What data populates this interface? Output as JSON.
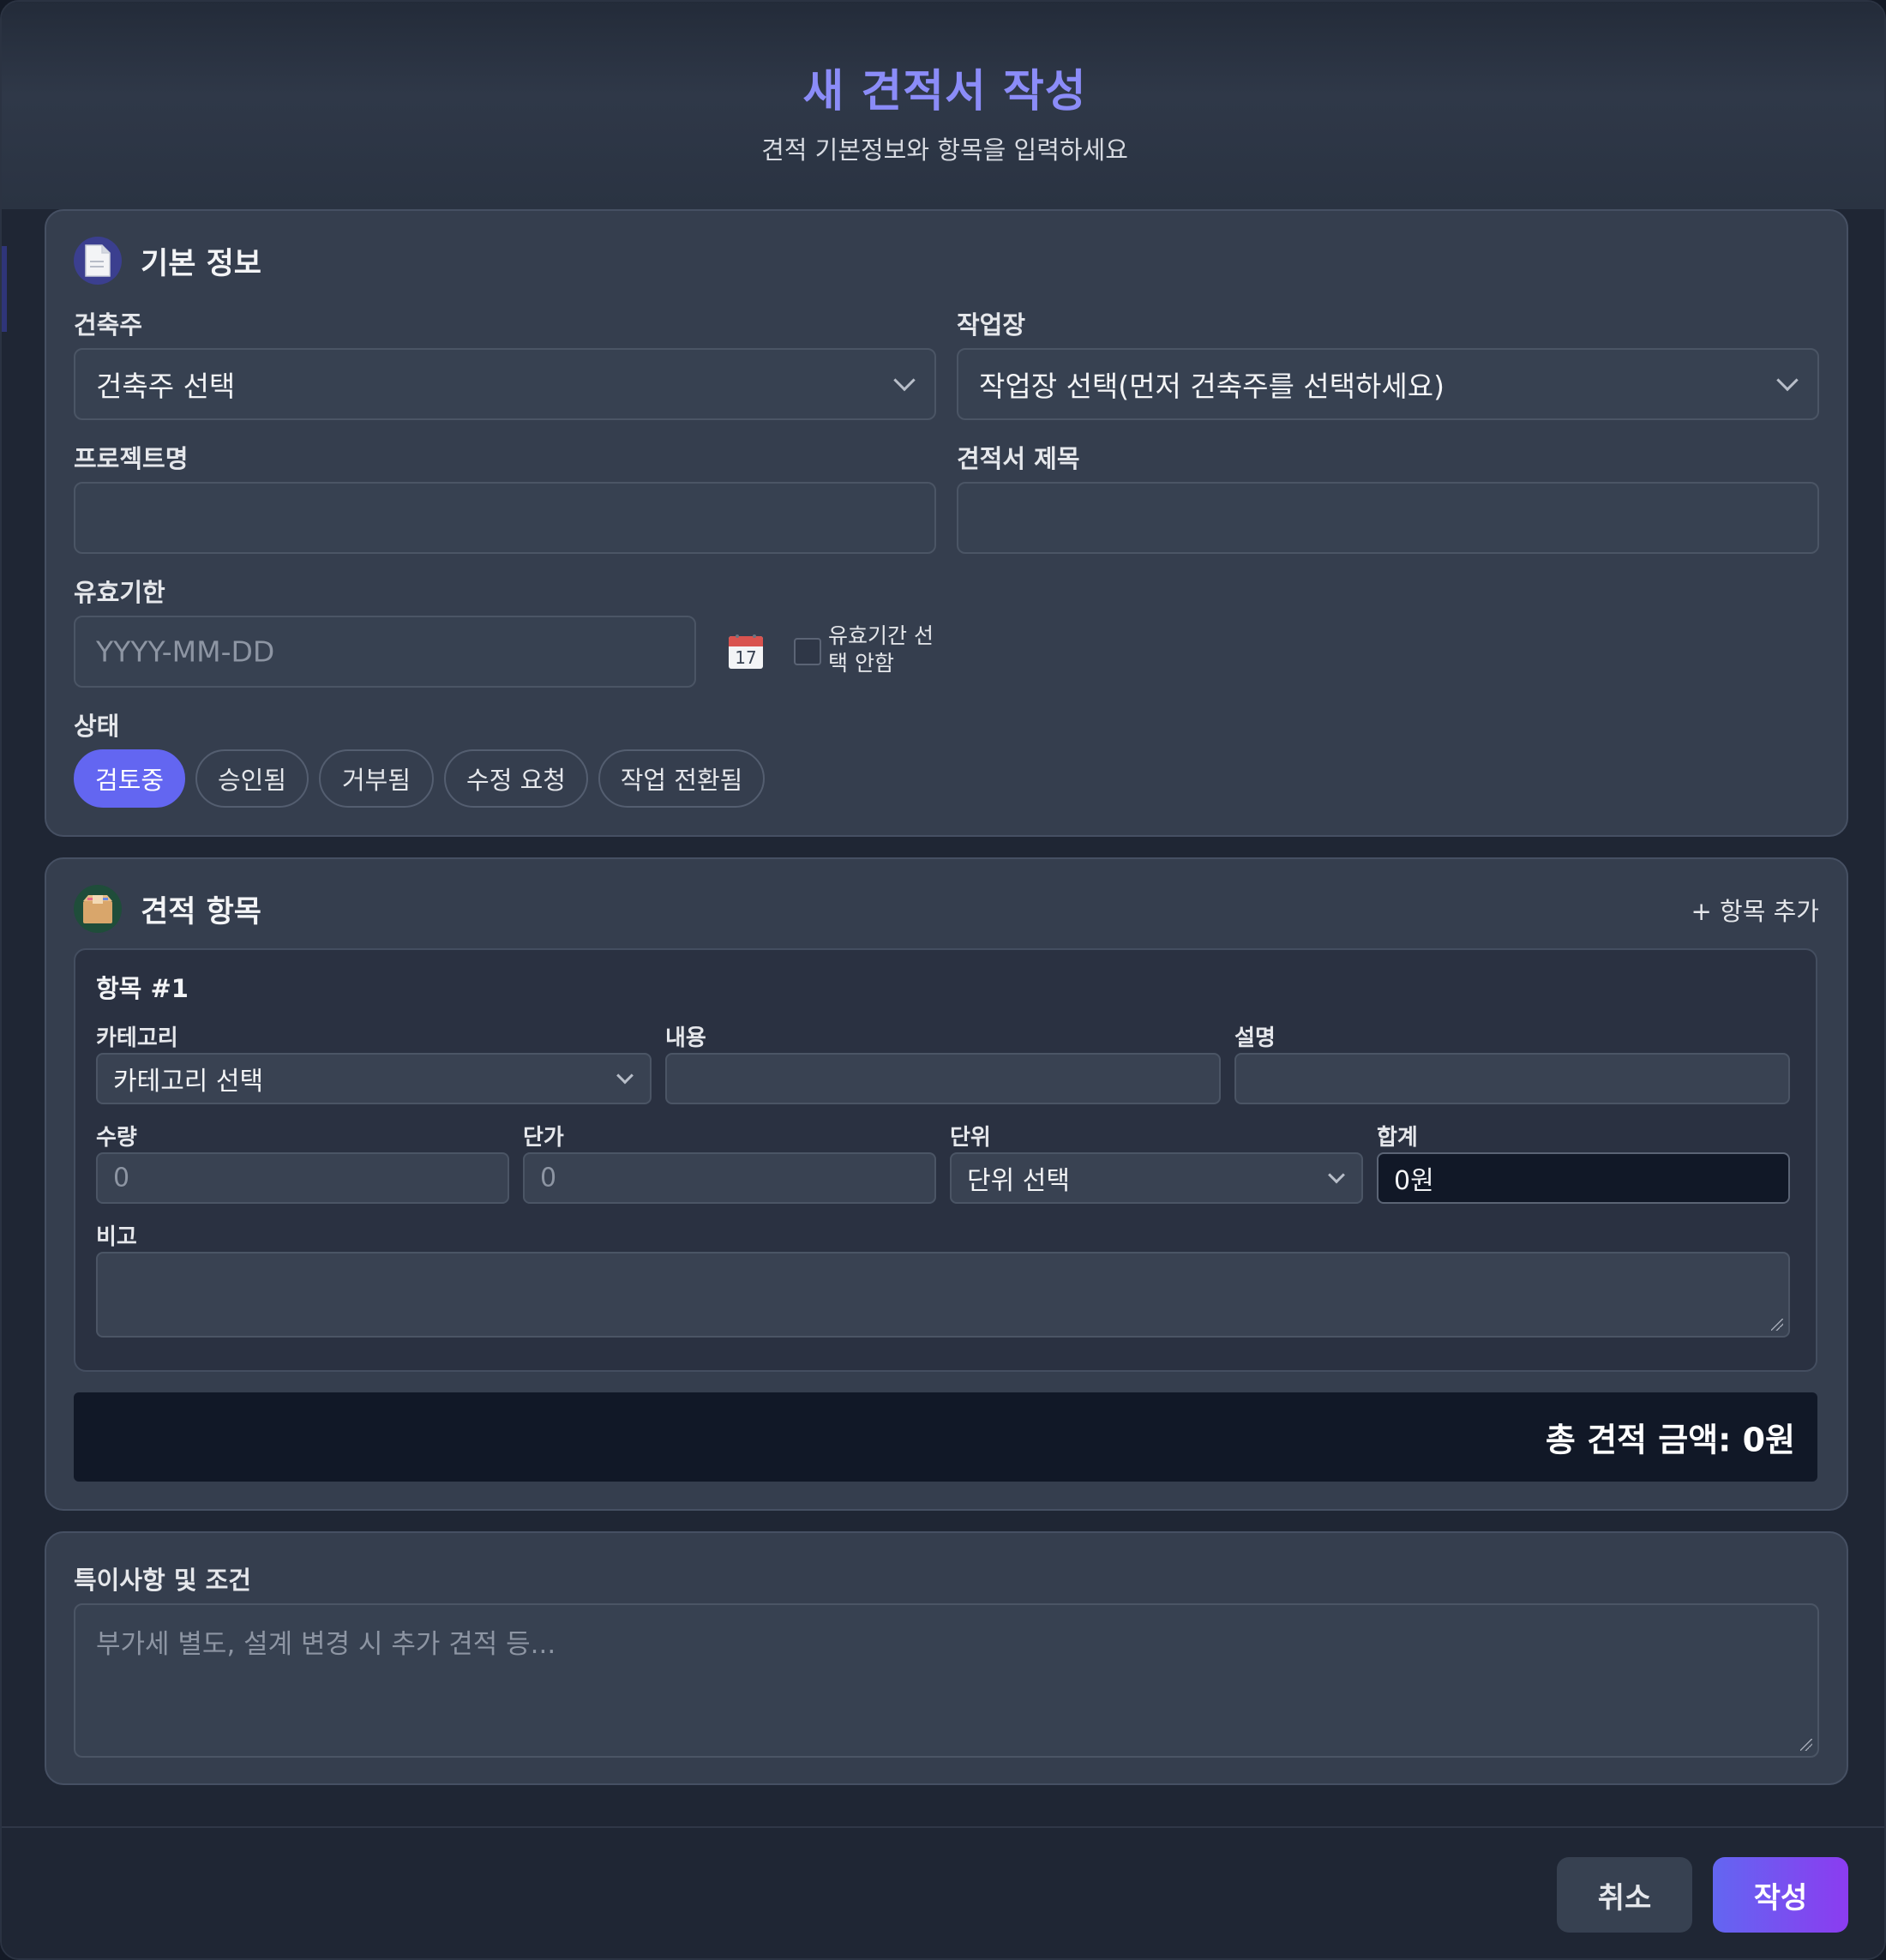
{
  "header": {
    "title": "새 견적서 작성",
    "subtitle": "견적 기본정보와 항목을 입력하세요"
  },
  "basic_info": {
    "section_title": "기본 정보",
    "section_icon": "document-icon",
    "client": {
      "label": "건축주",
      "value": "건축주 선택"
    },
    "site": {
      "label": "작업장",
      "value": "작업장 선택(먼저 건축주를 선택하세요)"
    },
    "project_name": {
      "label": "프로젝트명",
      "value": ""
    },
    "quote_title": {
      "label": "견적서 제목",
      "value": ""
    },
    "valid_until": {
      "label": "유효기한",
      "placeholder": "YYYY-MM-DD",
      "calendar_day": "17",
      "no_validity_line1": "유효기간 선",
      "no_validity_line2": "택 안함",
      "no_validity_checked": false
    },
    "status": {
      "label": "상태",
      "options": [
        "검토중",
        "승인됨",
        "거부됨",
        "수정 요청",
        "작업 전환됨"
      ],
      "selected": "검토중"
    }
  },
  "items": {
    "section_title": "견적 항목",
    "section_icon": "package-icon",
    "add_label": "+ 항목 추가",
    "list": [
      {
        "title": "항목 #1",
        "category": {
          "label": "카테고리",
          "value": "카테고리 선택"
        },
        "content": {
          "label": "내용",
          "value": ""
        },
        "description": {
          "label": "설명",
          "value": ""
        },
        "quantity": {
          "label": "수량",
          "placeholder": "0"
        },
        "unit_price": {
          "label": "단가",
          "placeholder": "0"
        },
        "unit": {
          "label": "단위",
          "value": "단위 선택"
        },
        "total": {
          "label": "합계",
          "value": "0원"
        },
        "remarks": {
          "label": "비고",
          "value": ""
        }
      }
    ],
    "grand_total": "총 견적 금액: 0원"
  },
  "notes": {
    "label": "특이사항 및 조건",
    "placeholder": "부가세 별도, 설계 변경 시 추가 견적 등..."
  },
  "footer": {
    "cancel_label": "취소",
    "submit_label": "작성"
  },
  "colors": {
    "accent": "#6366f1",
    "title": "#8b8cf8",
    "card_bg": "#353e4e",
    "modal_bg": "#1f2634"
  }
}
